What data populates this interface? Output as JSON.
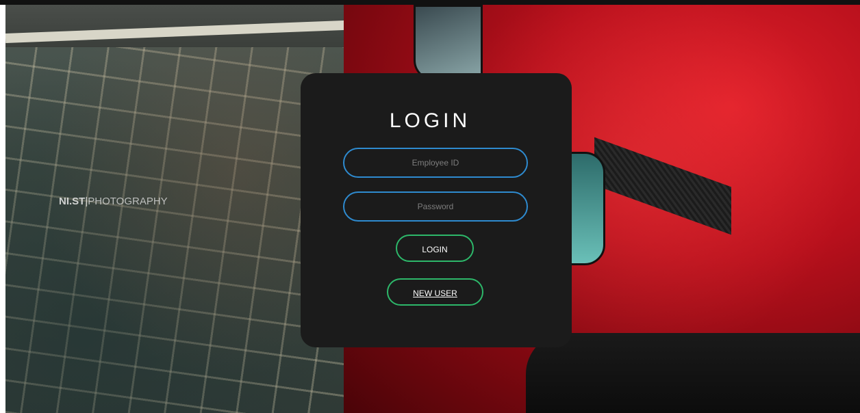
{
  "watermark": {
    "bold": "NI.ST",
    "separator": "|",
    "light": "PHOTOGRAPHY"
  },
  "login": {
    "title": "LOGIN",
    "employee_id_placeholder": "Employee ID",
    "employee_id_value": "",
    "password_placeholder": "Password",
    "password_value": "",
    "login_button": "LOGIN",
    "new_user_button": "NEW USER"
  },
  "colors": {
    "card_background": "#1b1b1b",
    "input_border": "#2e8bd0",
    "button_border": "#2db86a",
    "title_text": "#ffffff"
  }
}
